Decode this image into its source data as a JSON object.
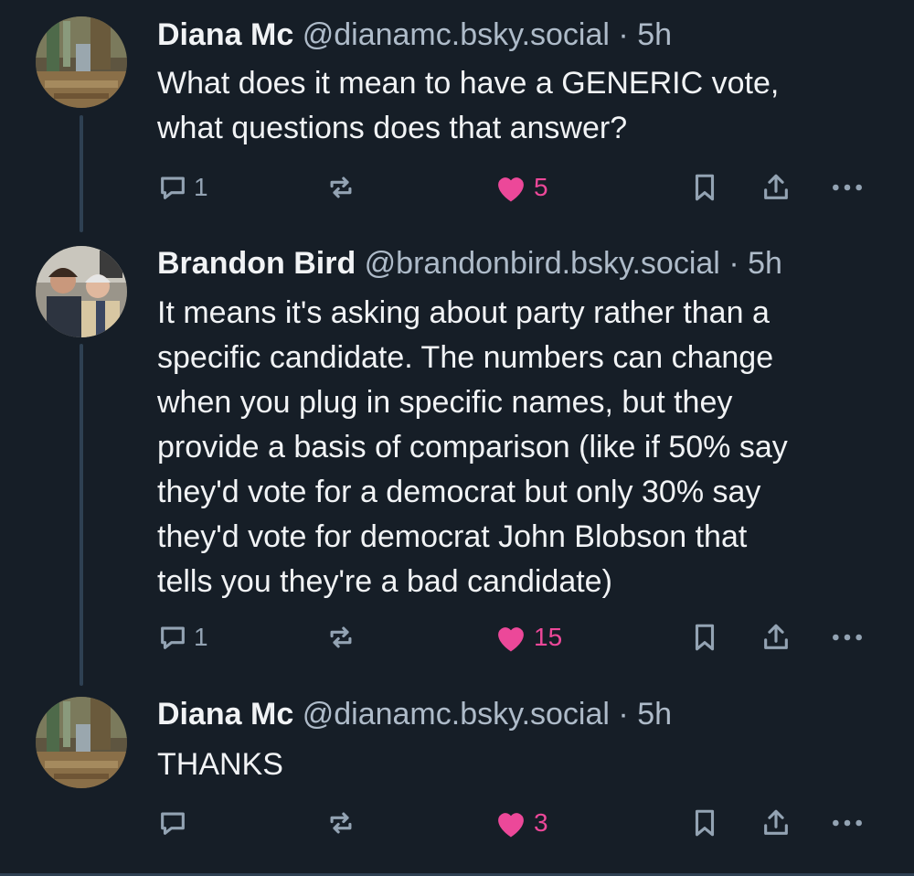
{
  "thread": {
    "posts": [
      {
        "author": "Diana Mc",
        "handle": "@dianamc.bsky.social",
        "separator": "·",
        "time": "5h",
        "text": "What does it mean to have a GENERIC vote,\nwhat questions does that answer?",
        "reply_count": "1",
        "like_count": "5",
        "liked": true,
        "avatar_icon": "avatar-photo-icon"
      },
      {
        "author": "Brandon Bird",
        "handle": "@brandonbird.bsky.social",
        "separator": "·",
        "time": "5h",
        "text": "It means it's asking about party rather than a\nspecific candidate. The numbers can change\nwhen you plug in specific names, but they\nprovide a basis of comparison (like if 50% say\nthey'd vote for a democrat but only 30% say\nthey'd vote for democrat John Blobson that\ntells you they're a bad candidate)",
        "reply_count": "1",
        "like_count": "15",
        "liked": true,
        "avatar_icon": "avatar-photo-icon"
      },
      {
        "author": "Diana Mc",
        "handle": "@dianamc.bsky.social",
        "separator": "·",
        "time": "5h",
        "text": "THANKS",
        "reply_count": "",
        "like_count": "3",
        "liked": true,
        "avatar_icon": "avatar-photo-icon"
      }
    ]
  },
  "icons": {
    "reply": "speech-bubble-icon",
    "repost": "repost-arrows-icon",
    "like": "heart-icon",
    "bookmark": "bookmark-icon",
    "share": "share-upload-icon",
    "more": "ellipsis-icon"
  },
  "colors": {
    "background": "#161e27",
    "text": "#f1f3f5",
    "muted": "#aebbc9",
    "icon": "#93a3b3",
    "like": "#ec4899",
    "thread_line": "#2e4052"
  }
}
